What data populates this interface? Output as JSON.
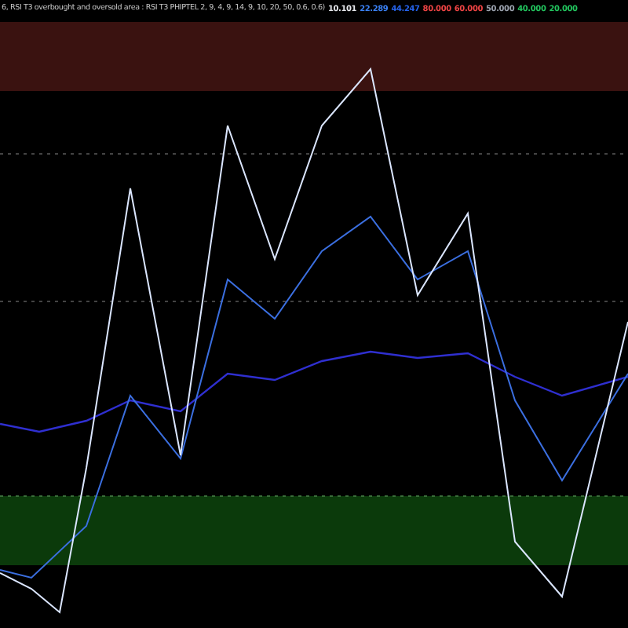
{
  "indicator": {
    "title": "6, RSI T3 overbought and oversold area : RSI T3 PHIPTEL 2, 9, 4, 9, 14, 9, 10, 20, 50, 0.6, 0.6)",
    "values": [
      {
        "text": "10.101",
        "color": "#e5e7eb"
      },
      {
        "text": "22.289",
        "color": "#3b82f6"
      },
      {
        "text": "44.247",
        "color": "#2563eb"
      },
      {
        "text": "80.000",
        "color": "#ef4444"
      },
      {
        "text": "60.000",
        "color": "#ef4444"
      },
      {
        "text": "50.000",
        "color": "#9ca3af"
      },
      {
        "text": "40.000",
        "color": "#22c55e"
      },
      {
        "text": "20.000",
        "color": "#22c55e"
      }
    ]
  }
}
